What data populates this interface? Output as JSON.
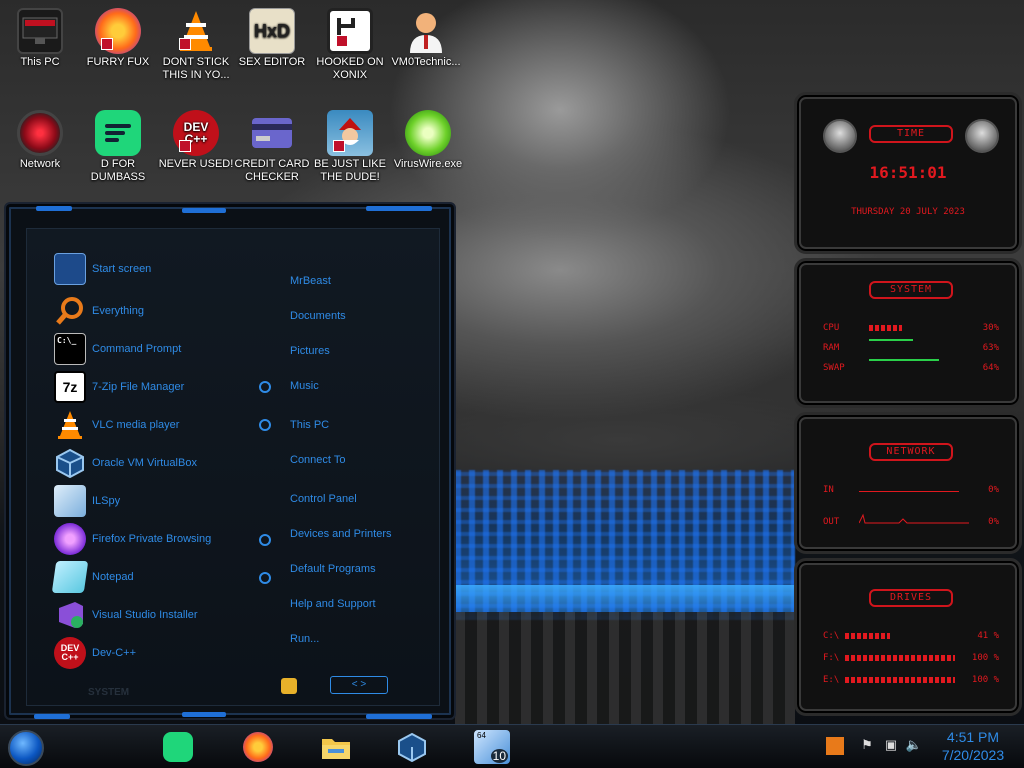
{
  "desktop_icons": [
    {
      "label": "This PC",
      "icon": "monitor-icon",
      "color": "#2a2a2a"
    },
    {
      "label": "FURRY FUX",
      "icon": "firefox-icon",
      "color": "#ff7a1a"
    },
    {
      "label": "DONT STICK THIS IN YO...",
      "icon": "vlc-cone-icon",
      "color": "#ff8a00"
    },
    {
      "label": "SEX EDITOR",
      "icon": "hxd-icon",
      "color": "#c8a040"
    },
    {
      "label": "HOOKED ON XONIX",
      "icon": "xonix-icon",
      "color": "#ffffff"
    },
    {
      "label": "VM0Technic...",
      "icon": "doctor-icon",
      "color": "#f2b27a"
    },
    {
      "label": "Network",
      "icon": "network-icon",
      "color": "#b01020"
    },
    {
      "label": "D FOR DUMBASS",
      "icon": "lines-icon",
      "color": "#1fd67a"
    },
    {
      "label": "NEVER USED!",
      "icon": "devcpp-icon",
      "color": "#c0101a"
    },
    {
      "label": "CREDIT CARD CHECKER",
      "icon": "credit-card-icon",
      "color": "#6a66cc"
    },
    {
      "label": "BE JUST LIKE THE DUDE!",
      "icon": "santa-icon",
      "color": "#3a8ac0"
    },
    {
      "label": "VirusWire.exe",
      "icon": "lime-icon",
      "color": "#6ed12a"
    }
  ],
  "start_menu": {
    "programs": [
      {
        "label": "Start screen",
        "icon": "start-screen-icon",
        "color": "#1d4a8a"
      },
      {
        "label": "Everything",
        "icon": "magnifier-icon",
        "color": "#e87a1a"
      },
      {
        "label": "Command Prompt",
        "icon": "cmd-icon",
        "color": "#000000"
      },
      {
        "label": "7-Zip File Manager",
        "icon": "7zip-icon",
        "color": "#000000"
      },
      {
        "label": "VLC media player",
        "icon": "vlc-cone-icon",
        "color": "#ff8a00"
      },
      {
        "label": "Oracle VM VirtualBox",
        "icon": "virtualbox-icon",
        "color": "#1a4f8a"
      },
      {
        "label": "ILSpy",
        "icon": "ilspy-icon",
        "color": "#7aaedc"
      },
      {
        "label": "Firefox Private Browsing",
        "icon": "firefox-private-icon",
        "color": "#7b2bd8"
      },
      {
        "label": "Notepad",
        "icon": "notepad-icon",
        "color": "#5ac8e0"
      },
      {
        "label": "Visual Studio Installer",
        "icon": "vs-installer-icon",
        "color": "#8a4fd8"
      },
      {
        "label": "Dev-C++",
        "icon": "devcpp-icon",
        "color": "#c0101a"
      }
    ],
    "places": [
      "MrBeast",
      "Documents",
      "Pictures",
      "Music",
      "This PC",
      "Connect To",
      "Control Panel",
      "Devices and Printers",
      "Default Programs",
      "Help and Support",
      "Run..."
    ],
    "footer_label": "SYSTEM",
    "nav_label": "< >"
  },
  "gadget": {
    "time": {
      "title": "TIME",
      "clock": "16:51:01",
      "date": "THURSDAY 20 JULY 2023"
    },
    "system": {
      "title": "SYSTEM",
      "rows": [
        {
          "label": "CPU",
          "value": "30%",
          "fill": 0.3
        },
        {
          "label": "RAM",
          "value": "63%",
          "fill": 0.63
        },
        {
          "label": "SWAP",
          "value": "64%",
          "fill": 0.64
        }
      ]
    },
    "network": {
      "title": "NETWORK",
      "rows": [
        {
          "label": "IN",
          "value": "0%"
        },
        {
          "label": "OUT",
          "value": "0%"
        }
      ]
    },
    "drives": {
      "title": "DRIVES",
      "rows": [
        {
          "label": "C:\\",
          "value": "41 %",
          "fill": 0.41
        },
        {
          "label": "F:\\",
          "value": "100 %",
          "fill": 1.0
        },
        {
          "label": "E:\\",
          "value": "100 %",
          "fill": 1.0
        }
      ]
    }
  },
  "taskbar": {
    "apps": [
      {
        "icon": "lines-icon",
        "color": "#1fd67a"
      },
      {
        "icon": "firefox-icon",
        "color": "#ff7a1a"
      },
      {
        "icon": "file-explorer-icon",
        "color": "#f2c64a"
      },
      {
        "icon": "virtualbox-icon",
        "color": "#1a4f8a"
      },
      {
        "icon": "win10-icon",
        "color": "#4a90d8"
      }
    ],
    "win10_badge_top": "64",
    "win10_badge_bottom": "10",
    "clock_time": "4:51 PM",
    "clock_date": "7/20/2023"
  }
}
